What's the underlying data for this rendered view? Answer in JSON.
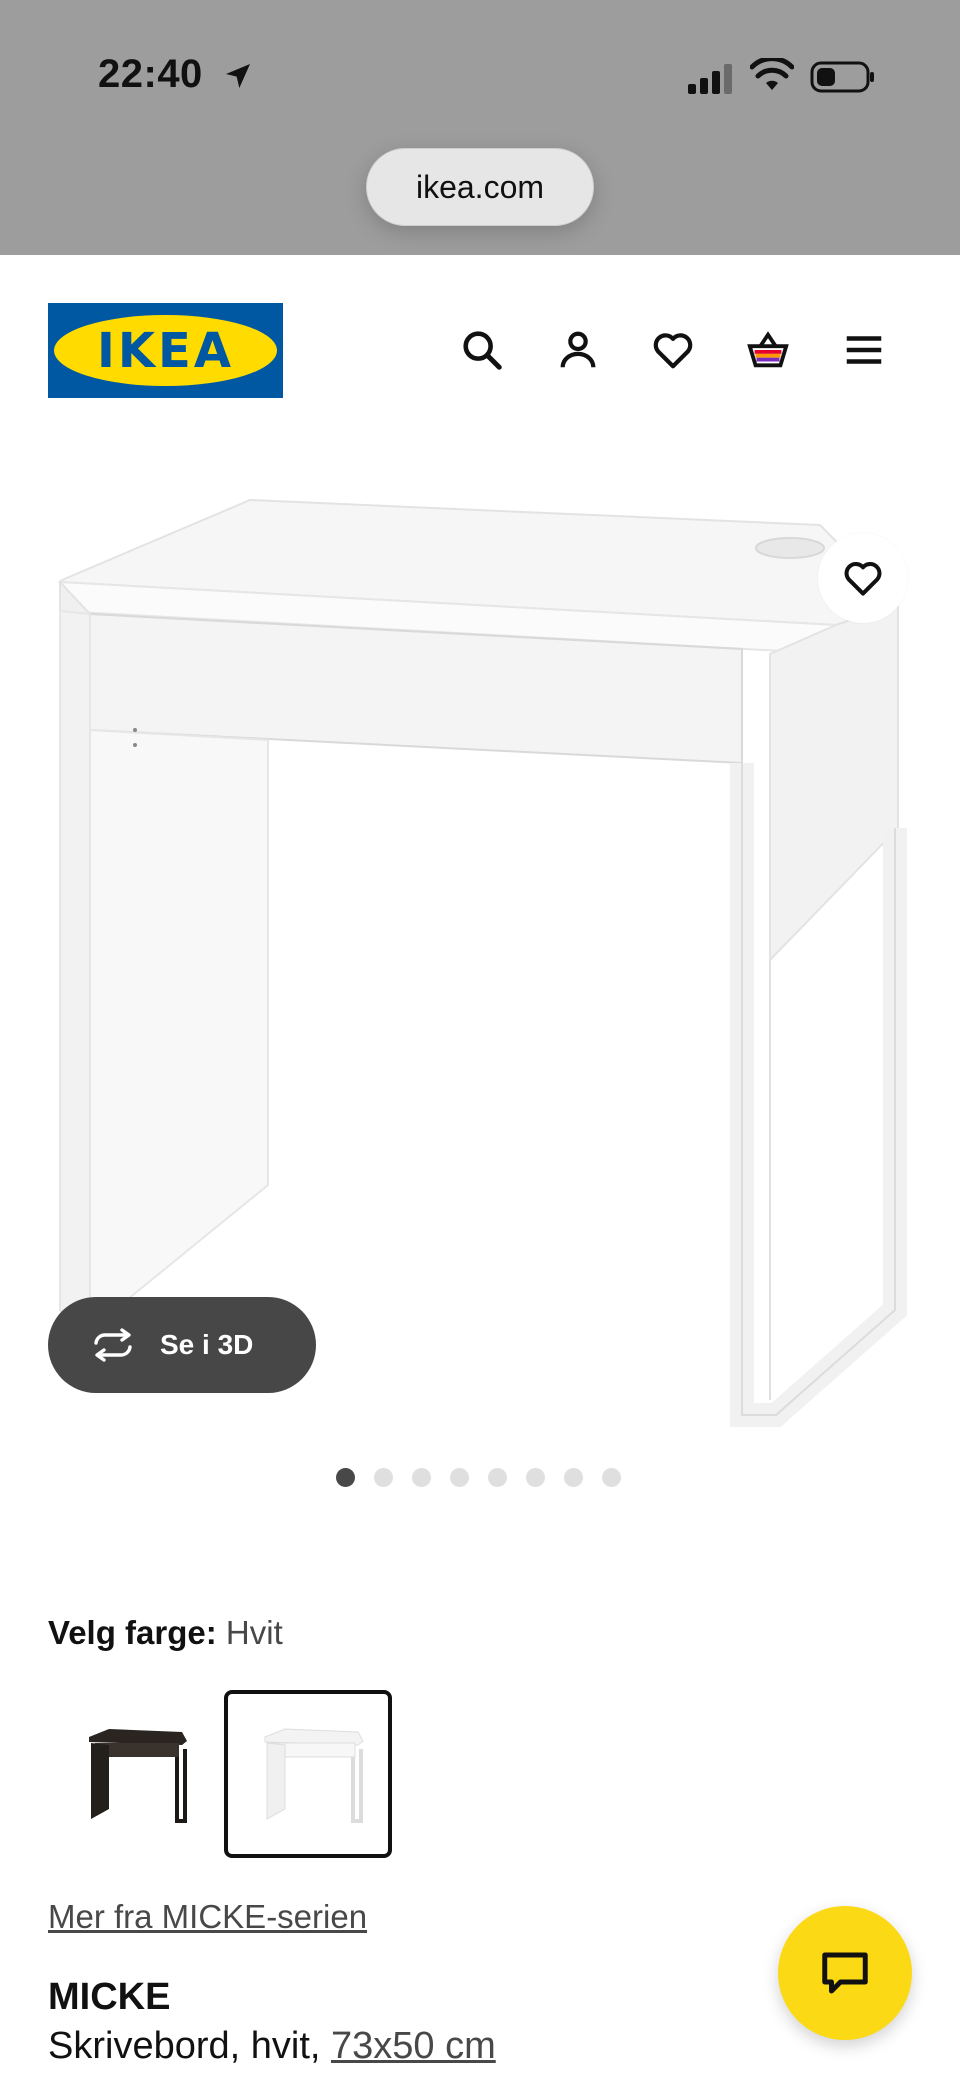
{
  "status_bar": {
    "time": "22:40"
  },
  "browser": {
    "url": "ikea.com"
  },
  "header": {
    "logo_text": "IKEA",
    "icons": [
      "search-icon",
      "account-icon",
      "wishlist-heart-icon",
      "cart-basket-icon",
      "menu-icon"
    ]
  },
  "product_media": {
    "view_3d_label": "Se i 3D",
    "image_count": 8,
    "active_index": 0
  },
  "color_selector": {
    "label": "Velg farge:",
    "selected_value": "Hvit",
    "options": [
      "dark",
      "white"
    ]
  },
  "series_link": "Mer fra MICKE-serien",
  "product": {
    "name": "MICKE",
    "description": "Skrivebord, hvit, ",
    "dimensions": "73x50 cm"
  },
  "colors": {
    "ikea_blue": "#0058a3",
    "ikea_yellow": "#ffdb00",
    "chat_yellow": "#fbd914"
  }
}
